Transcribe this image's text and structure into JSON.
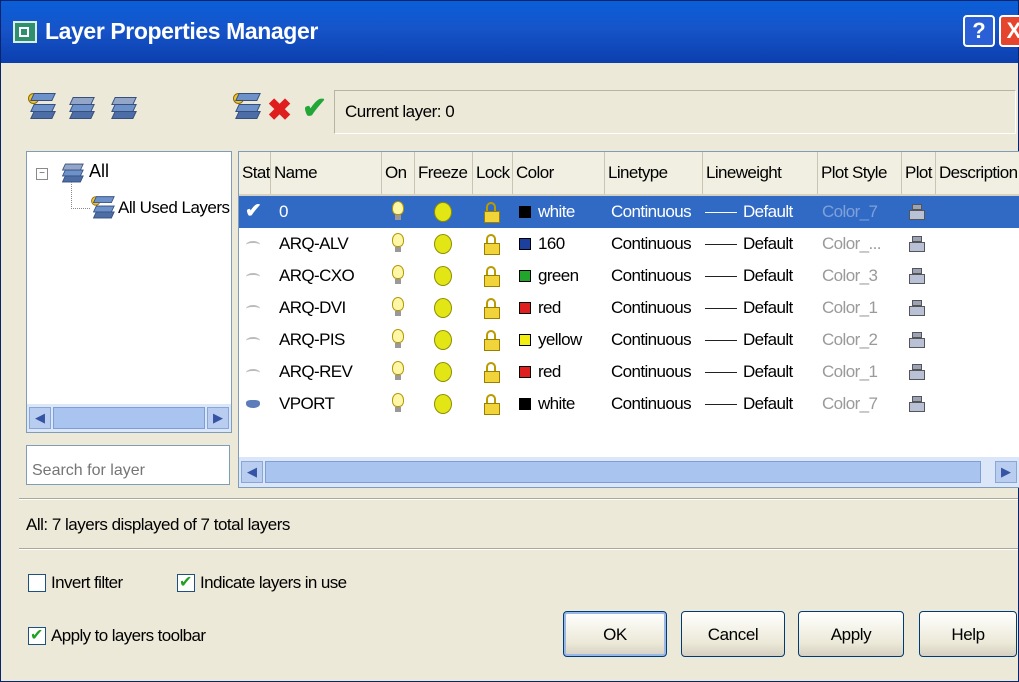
{
  "window": {
    "title": "Layer Properties Manager",
    "help_glyph": "?",
    "close_glyph": "X"
  },
  "toolbar": {
    "current_layer_label": "Current layer: 0",
    "left_icons": [
      "new-property-filter-icon",
      "new-group-filter-icon",
      "layer-states-manager-icon"
    ],
    "right_icons": [
      "new-layer-icon",
      "delete-layer-icon",
      "set-current-icon"
    ]
  },
  "tree": {
    "root_label": "All",
    "child_label": "All Used Layers"
  },
  "search": {
    "placeholder": "Search for layer"
  },
  "columns": [
    "Stat",
    "Name",
    "On",
    "Freeze",
    "Lock",
    "Color",
    "Linetype",
    "Lineweight",
    "Plot Style",
    "Plot",
    "Description"
  ],
  "layers": [
    {
      "name": "0",
      "status": "current",
      "color_name": "white",
      "swatch": "#000000",
      "linetype": "Continuous",
      "lineweight": "Default",
      "plot_style": "Color_7"
    },
    {
      "name": "ARQ-ALV",
      "status": "unused",
      "color_name": "160",
      "swatch": "#1d3f9e",
      "linetype": "Continuous",
      "lineweight": "Default",
      "plot_style": "Color_..."
    },
    {
      "name": "ARQ-CXO",
      "status": "unused",
      "color_name": "green",
      "swatch": "#22a52b",
      "linetype": "Continuous",
      "lineweight": "Default",
      "plot_style": "Color_3"
    },
    {
      "name": "ARQ-DVI",
      "status": "unused",
      "color_name": "red",
      "swatch": "#e01f1f",
      "linetype": "Continuous",
      "lineweight": "Default",
      "plot_style": "Color_1"
    },
    {
      "name": "ARQ-PIS",
      "status": "unused",
      "color_name": "yellow",
      "swatch": "#f2ee12",
      "linetype": "Continuous",
      "lineweight": "Default",
      "plot_style": "Color_2"
    },
    {
      "name": "ARQ-REV",
      "status": "unused",
      "color_name": "red",
      "swatch": "#e01f1f",
      "linetype": "Continuous",
      "lineweight": "Default",
      "plot_style": "Color_1"
    },
    {
      "name": "VPORT",
      "status": "in-use",
      "color_name": "white",
      "swatch": "#000000",
      "linetype": "Continuous",
      "lineweight": "Default",
      "plot_style": "Color_7"
    }
  ],
  "status_text": "All: 7 layers displayed of 7 total layers",
  "options": {
    "invert_filter": {
      "label": "Invert filter",
      "checked": false
    },
    "indicate_in_use": {
      "label": "Indicate layers in use",
      "checked": true
    },
    "apply_toolbar": {
      "label": "Apply to layers toolbar",
      "checked": true
    }
  },
  "buttons": {
    "ok": "OK",
    "cancel": "Cancel",
    "apply": "Apply",
    "help": "Help"
  },
  "colors": {
    "selection": "#316ac5",
    "titlebar": "#0a5fd8"
  }
}
